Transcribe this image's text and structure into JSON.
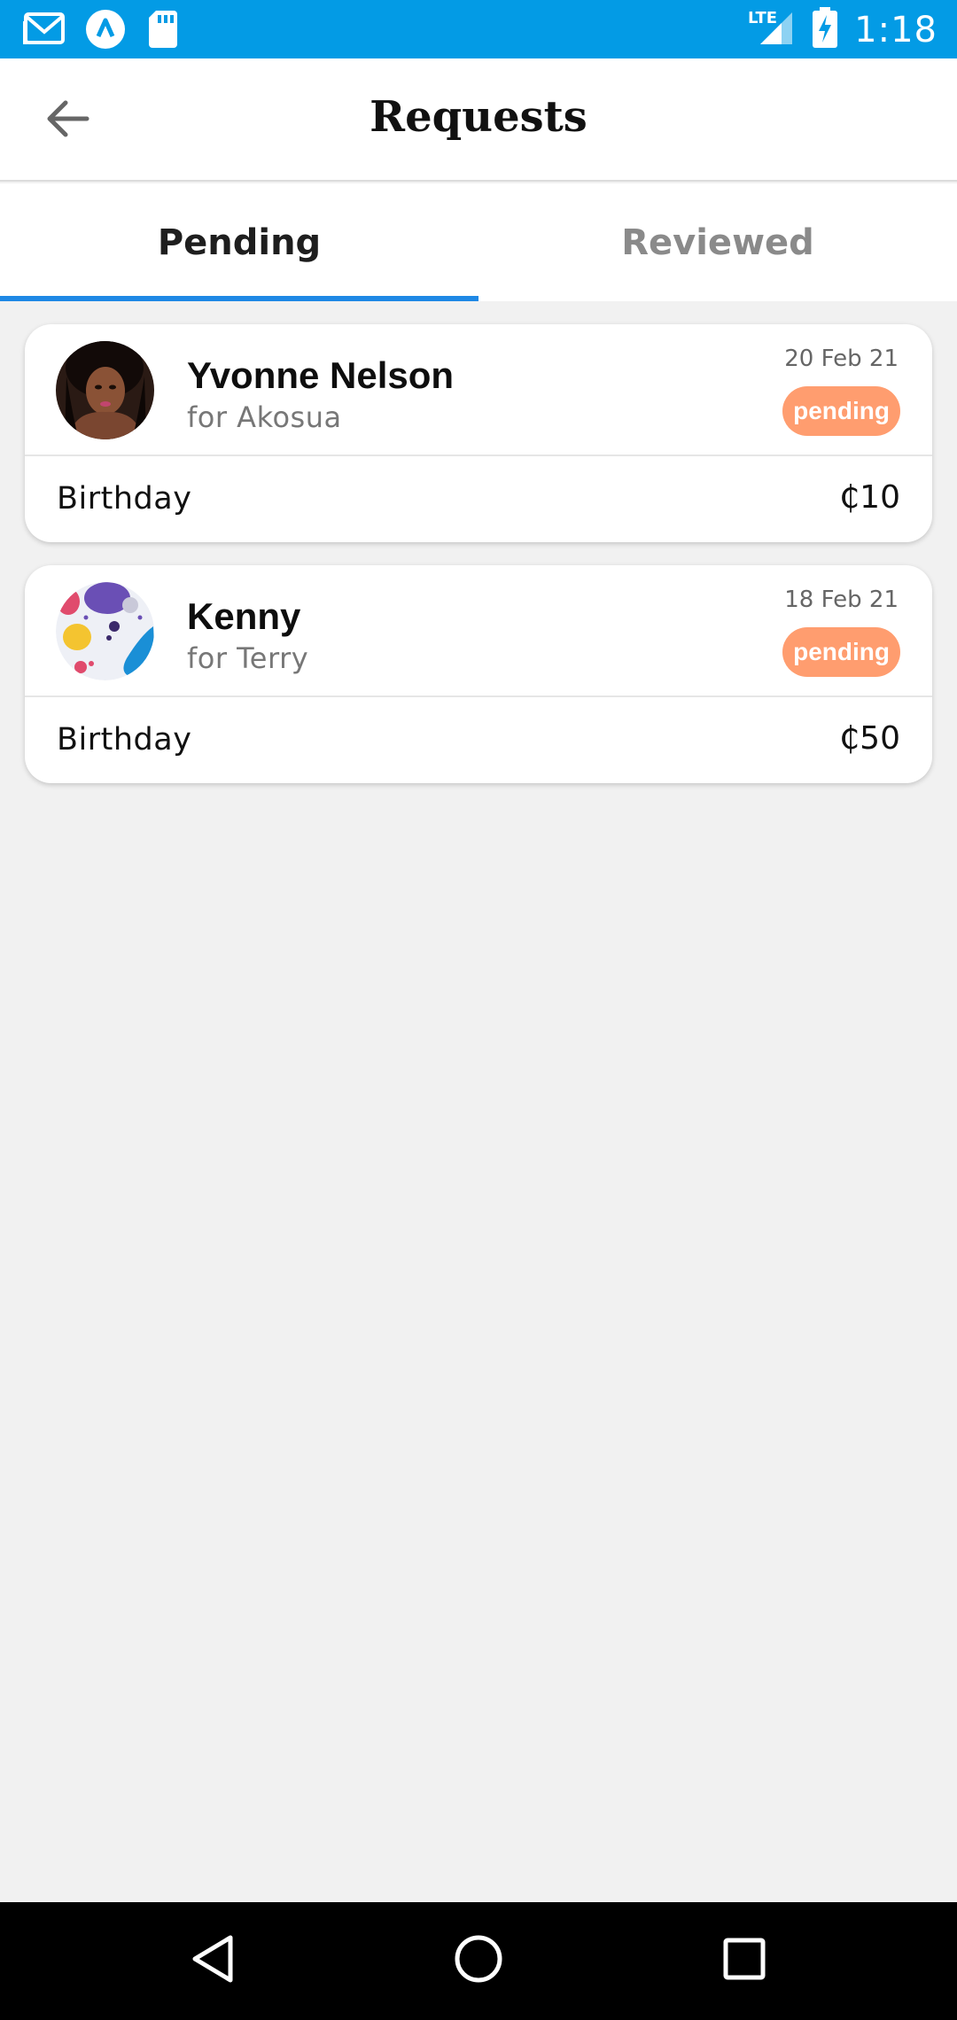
{
  "status_bar": {
    "time": "1:18",
    "network": "LTE",
    "icons": [
      "gmail-icon",
      "app-icon",
      "sd-card-icon",
      "signal-icon",
      "battery-charging-icon"
    ]
  },
  "header": {
    "title": "Requests",
    "back_icon": "arrow-left-icon"
  },
  "tabs": [
    {
      "label": "Pending",
      "active": true
    },
    {
      "label": "Reviewed",
      "active": false
    }
  ],
  "requests": [
    {
      "name": "Yvonne Nelson",
      "for_text": "for Akosua",
      "date": "20 Feb 21",
      "status": "pending",
      "occasion": "Birthday",
      "amount": "₵10",
      "avatar": "photo-avatar"
    },
    {
      "name": "Kenny",
      "for_text": "for Terry",
      "date": "18 Feb 21",
      "status": "pending",
      "occasion": "Birthday",
      "amount": "₵50",
      "avatar": "colorful-dots-avatar"
    }
  ],
  "colors": {
    "status_bar": "#039be5",
    "tab_indicator": "#1e88e5",
    "badge": "#ff9d6f",
    "background": "#f1f1f1"
  },
  "nav_bar": [
    "back-triangle-icon",
    "home-circle-icon",
    "recents-square-icon"
  ]
}
